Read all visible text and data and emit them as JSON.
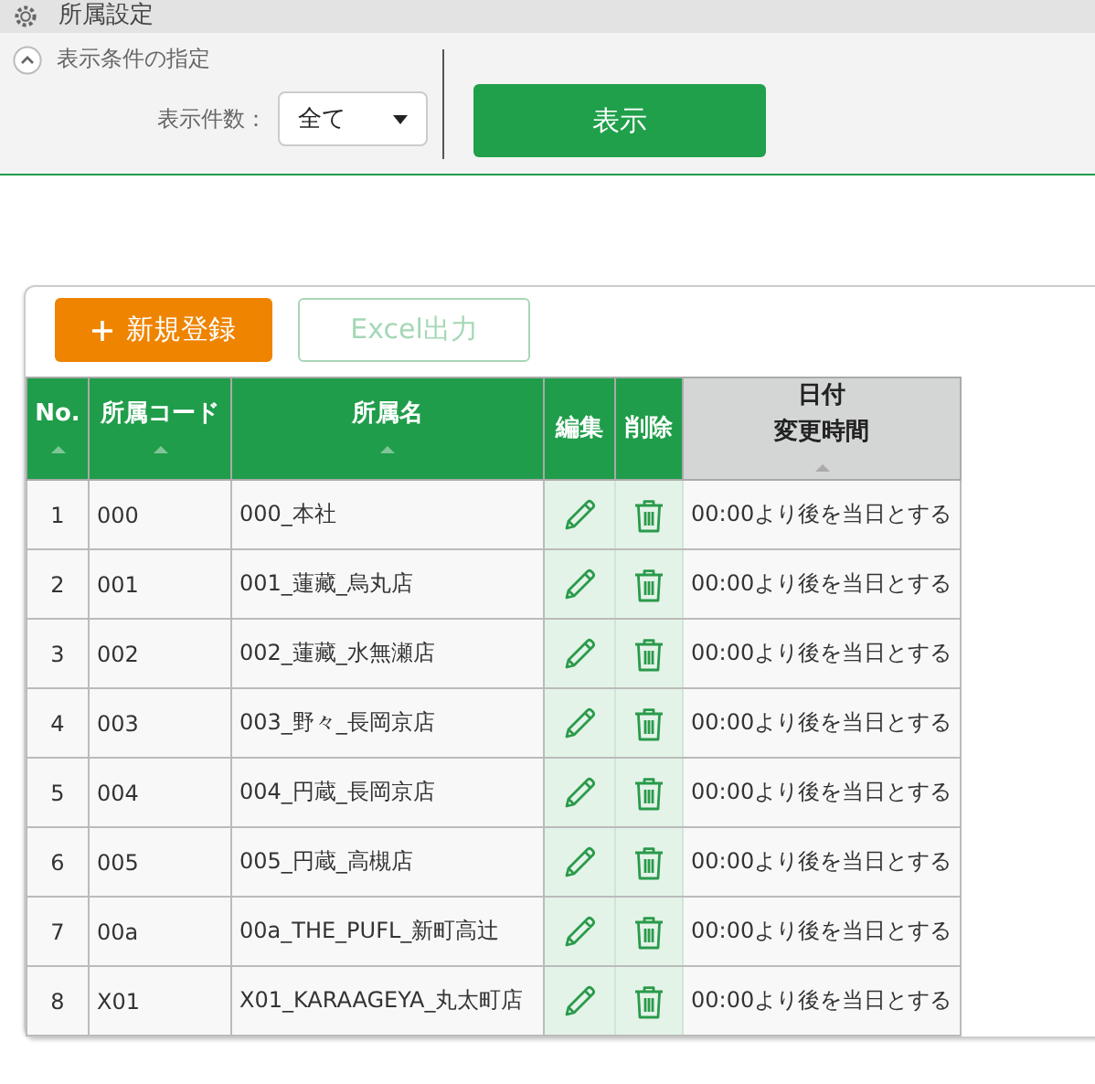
{
  "header": {
    "title": "所属設定"
  },
  "filter": {
    "toggle_expanded": true,
    "heading": "表示条件の指定",
    "count_label": "表示件数：",
    "count_value": "全て",
    "show_button": "表示"
  },
  "toolbar": [
    {
      "label": "新規登録",
      "kind": "add",
      "disabled": false
    },
    {
      "label": "Excel出力",
      "kind": "export",
      "disabled": true
    }
  ],
  "table": {
    "columns": [
      {
        "label": "No.",
        "sortable": true,
        "sorted": false
      },
      {
        "label": "所属コード",
        "sortable": true,
        "sorted": false
      },
      {
        "label": "所属名",
        "sortable": true,
        "sorted": false
      },
      {
        "label": "編集",
        "sortable": false,
        "sorted": false
      },
      {
        "label": "削除",
        "sortable": false,
        "sorted": false
      },
      {
        "label": "日付",
        "sublabel": "変更時間",
        "sortable": true,
        "sorted": true
      }
    ],
    "rows": [
      {
        "no": "1",
        "code": "000",
        "name": "000_本社",
        "rule": "00:00より後を当日とする"
      },
      {
        "no": "2",
        "code": "001",
        "name": "001_蓮藏_烏丸店",
        "rule": "00:00より後を当日とする"
      },
      {
        "no": "3",
        "code": "002",
        "name": "002_蓮藏_水無瀬店",
        "rule": "00:00より後を当日とする"
      },
      {
        "no": "4",
        "code": "003",
        "name": "003_野々_長岡京店",
        "rule": "00:00より後を当日とする"
      },
      {
        "no": "5",
        "code": "004",
        "name": "004_円蔵_長岡京店",
        "rule": "00:00より後を当日とする"
      },
      {
        "no": "6",
        "code": "005",
        "name": "005_円蔵_高槻店",
        "rule": "00:00より後を当日とする"
      },
      {
        "no": "7",
        "code": "00a",
        "name": "00a_THE_PUFL_新町高辻",
        "rule": "00:00より後を当日とする"
      },
      {
        "no": "8",
        "code": "X01",
        "name": "X01_KARAAGEYA_丸太町店",
        "rule": "00:00より後を当日とする"
      }
    ]
  }
}
